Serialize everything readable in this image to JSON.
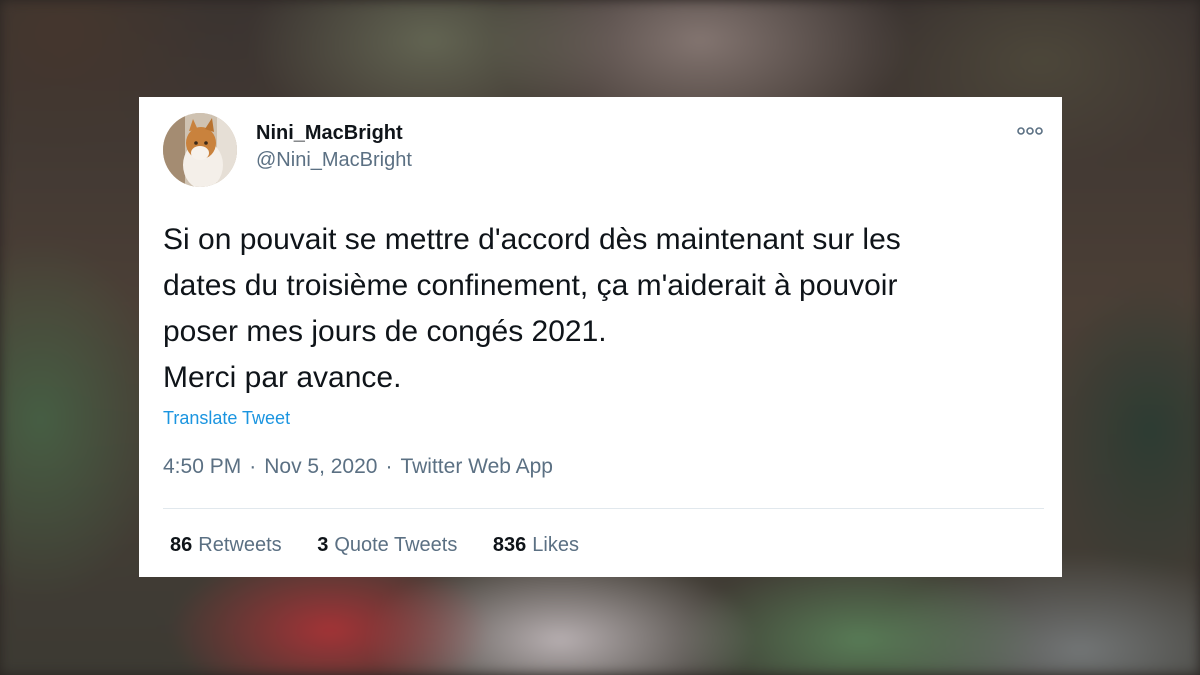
{
  "tweet": {
    "display_name": "Nini_MacBright",
    "handle": "@Nini_MacBright",
    "text_lines": [
      "Si on pouvait se mettre d'accord dès maintenant sur les",
      "dates du troisième confinement, ça m'aiderait à pouvoir",
      "poser mes jours de congés 2021.",
      "Merci par avance."
    ],
    "translate_label": "Translate Tweet",
    "time": "4:50 PM",
    "date": "Nov 5, 2020",
    "source": "Twitter Web App",
    "separator": "·",
    "more_icon": "more-dots-icon",
    "avatar_icon": "cat-avatar"
  },
  "stats": {
    "retweets_count": "86",
    "retweets_label": "Retweets",
    "quotes_count": "3",
    "quotes_label": "Quote Tweets",
    "likes_count": "836",
    "likes_label": "Likes"
  },
  "colors": {
    "text": "#0f1419",
    "secondary": "#5b7083",
    "link": "#1b95e0",
    "card": "#ffffff"
  }
}
